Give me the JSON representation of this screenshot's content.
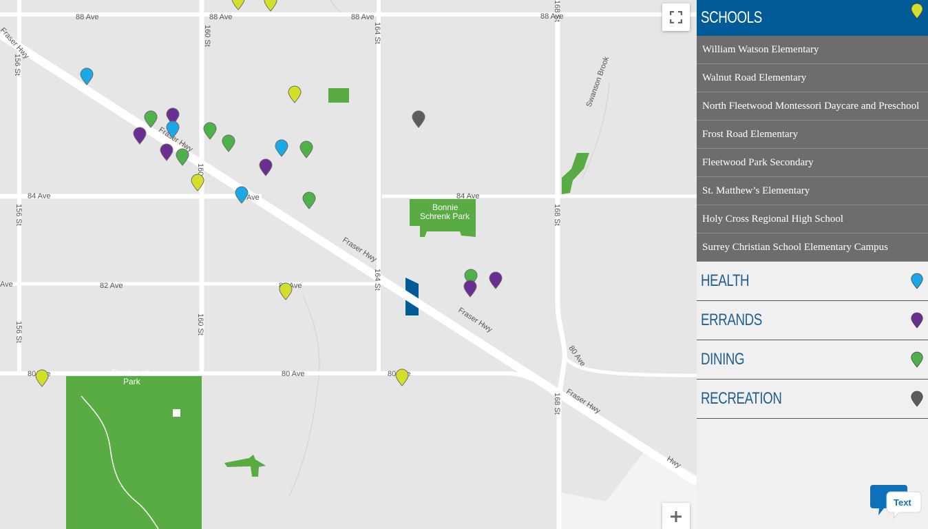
{
  "map": {
    "road_labels": {
      "ave_88_a": "88 Ave",
      "ave_88_b": "88 Ave",
      "ave_88_c": "88 Ave",
      "ave_88_d": "88 Ave",
      "ave_84_a": "84 Ave",
      "ave_84_b": "Ave",
      "ave_84_c": "84 Ave",
      "ave_82_a": "82 Ave",
      "ave_82_b": "82 Ave",
      "ave_82_edge": "Ave",
      "ave_80_a": "80 Ave",
      "ave_80_b": "80 Ave",
      "ave_80_c": "80 Ave",
      "ave_80_d": "80 Ave",
      "st_156_a": "156 St",
      "st_156_b": "156 St",
      "st_156_c": "156 St",
      "st_160_a": "160 St",
      "st_160_b": "160",
      "st_160_c": "160 St",
      "st_164_a": "164 St",
      "st_164_b": "164 St",
      "st_168_a": "168 St",
      "st_168_b": "168 St",
      "st_168_c": "168 St",
      "hwy_a": "Fraser Hwy",
      "hwy_b": "Fraser Hwy",
      "hwy_c": "Fraser Hwy",
      "hwy_d": "Fraser Hwy",
      "hwy_e": "Fraser Hwy",
      "hwy_f": "Hwy",
      "brook": "Swanson Brook"
    },
    "parks": {
      "bonnie_line1": "Bonnie",
      "bonnie_line2": "Schrenk Park",
      "fleetwood_line1": "Fleetwood",
      "fleetwood_line2": "Park"
    },
    "controls": {
      "fullscreen_icon": "fullscreen-icon",
      "zoom_in_icon": "plus-icon"
    }
  },
  "marker_colors": {
    "schools": "#d4df2a",
    "health": "#1aa8e6",
    "errands": "#6a2d91",
    "dining": "#4db24a",
    "recreation": "#5c5c5c"
  },
  "panel": {
    "categories": [
      {
        "key": "schools",
        "label": "SCHOOLS",
        "active": true,
        "items": [
          "William Watson Elementary",
          "Walnut Road Elementary",
          "North Fleetwood Montessori Daycare and Preschool",
          "Frost Road Elementary",
          "Fleetwood Park Secondary",
          "St. Matthew’s Elementary",
          "Holy Cross Regional High School",
          "Surrey Christian School Elementary Campus"
        ]
      },
      {
        "key": "health",
        "label": "HEALTH",
        "active": false
      },
      {
        "key": "errands",
        "label": "ERRANDS",
        "active": false
      },
      {
        "key": "dining",
        "label": "DINING",
        "active": false
      },
      {
        "key": "recreation",
        "label": "RECREATION",
        "active": false
      }
    ]
  },
  "chat_widget": {
    "label": "Text",
    "icon": "chat-bubble-icon"
  }
}
